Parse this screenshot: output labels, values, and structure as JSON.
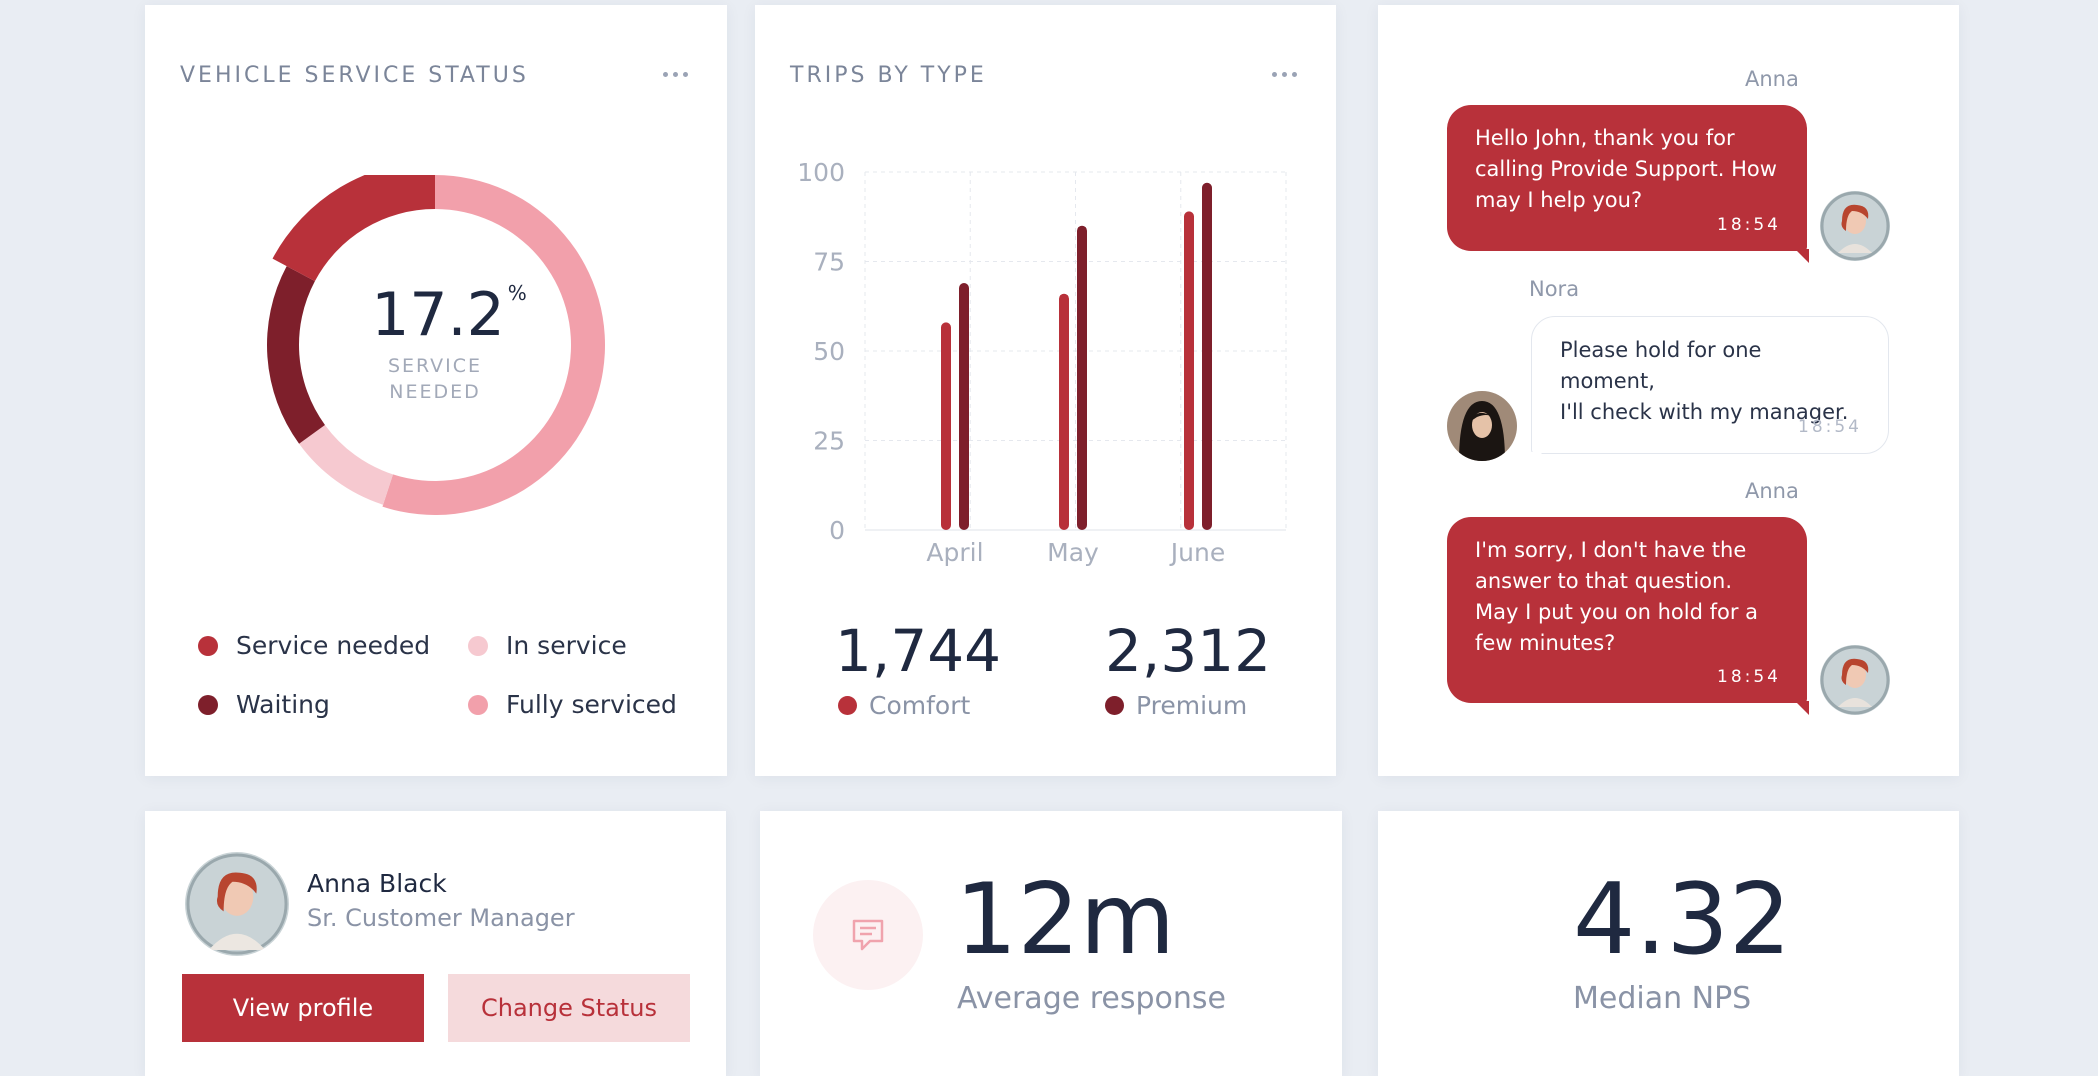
{
  "colors": {
    "accent": "#b8313a",
    "dark_red": "#7e1f2b",
    "light_pink": "#f6c9d0",
    "pink": "#f2a0ab"
  },
  "vehicle_card": {
    "title": "VEHICLE SERVICE STATUS",
    "menu_icon": "more-horizontal-icon",
    "center_value": "17.2",
    "center_unit": "%",
    "center_label_1": "SERVICE",
    "center_label_2": "NEEDED",
    "legend": [
      {
        "label": "Service needed",
        "color": "#b8313a"
      },
      {
        "label": "In service",
        "color": "#f6c9d0"
      },
      {
        "label": "Waiting",
        "color": "#7e1f2b"
      },
      {
        "label": "Fully serviced",
        "color": "#f2a0ab"
      }
    ]
  },
  "chart_data": {
    "type": "bar",
    "title": "TRIPS BY TYPE",
    "categories": [
      "April",
      "May",
      "June"
    ],
    "series": [
      {
        "name": "Comfort",
        "color": "#b8313a",
        "values": [
          58,
          66,
          89
        ]
      },
      {
        "name": "Premium",
        "color": "#7e1f2b",
        "values": [
          69,
          85,
          97
        ]
      }
    ],
    "yticks": [
      "100",
      "75",
      "50",
      "25",
      "0"
    ],
    "ylim": [
      0,
      100
    ],
    "grid": true
  },
  "trips_card": {
    "title": "TRIPS BY TYPE",
    "menu_icon": "more-horizontal-icon",
    "stat_1_value": "1,744",
    "stat_1_label": "Comfort",
    "stat_2_value": "2,312",
    "stat_2_label": "Premium"
  },
  "chat": {
    "messages": [
      {
        "sender": "Anna",
        "text_lines": [
          "Hello John, thank you for",
          "calling Provide Support. How",
          "may I help you?"
        ],
        "time": "18:54"
      },
      {
        "sender": "Nora",
        "text_lines": [
          "Please hold for one moment,",
          "I'll check with my manager."
        ],
        "time": "18:54"
      },
      {
        "sender": "Anna",
        "text_lines": [
          "I'm sorry, I don't have the",
          "answer to that question.",
          "May I put you on hold for a",
          "few minutes?"
        ],
        "time": "18:54"
      }
    ]
  },
  "profile": {
    "name": "Anna Black",
    "role": "Sr. Customer Manager",
    "view_button": "View profile",
    "status_button": "Change Status"
  },
  "response": {
    "icon": "chat-message-icon",
    "value": "12m",
    "label": "Average response"
  },
  "nps": {
    "value": "4.32",
    "label": "Median NPS"
  }
}
